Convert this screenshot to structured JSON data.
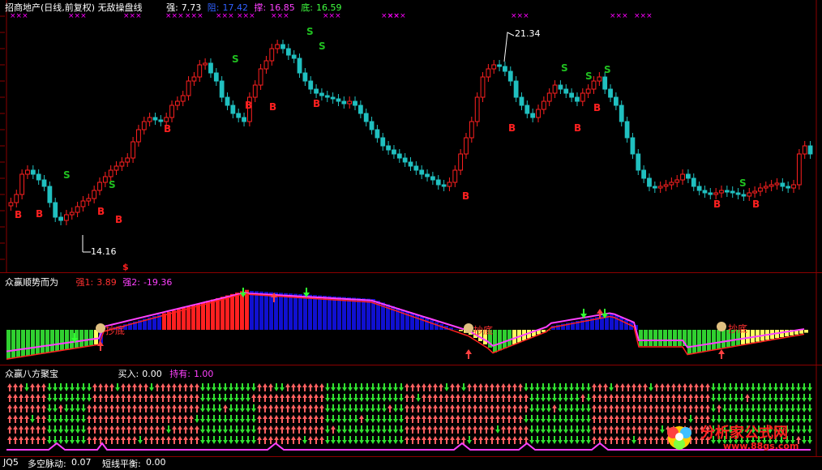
{
  "main_panel": {
    "title": "招商地产(日线,前复权) 无敌操盘线",
    "strong_label": "强:",
    "strong_value": "7.73",
    "resist_label": "阻:",
    "resist_value": "17.42",
    "support_label": "撑:",
    "support_value": "16.85",
    "bottom_label": "底:",
    "bottom_value": "16.59",
    "high_marker": "21.34",
    "low_marker": "14.16",
    "buy_signal_text": "B",
    "sell_signal_text": "S",
    "dollar_text": "$",
    "x_mark_text": "×××",
    "colors": {
      "up": "#ff2020",
      "down": "#20c0c0",
      "buy": "#ff2020",
      "sell": "#20c020",
      "cross": "#ff00ff"
    }
  },
  "panel2": {
    "title": "众赢顺势而为",
    "strong1_label": "强1:",
    "strong1_value": "3.89",
    "strong2_label": "强2:",
    "strong2_value": "-19.36",
    "bottom_label": "抄底",
    "colors": {
      "yellow": "#ffff60",
      "green": "#30d030",
      "red": "#ff2020",
      "blue": "#1010d0",
      "magenta": "#ff40ff"
    }
  },
  "panel3": {
    "title": "众赢八方聚宝",
    "buy_label": "买入:",
    "buy_value": "0.00",
    "hold_label": "持有:",
    "hold_value": "1.00"
  },
  "status": {
    "jq5": "JQ5",
    "long_short_label": "多空脉动:",
    "long_short_value": "0.07",
    "short_balance_label": "短线平衡:",
    "short_balance_value": "0.00"
  },
  "watermark": {
    "text": "分析家公式网",
    "url": "www.88gs.com"
  }
}
